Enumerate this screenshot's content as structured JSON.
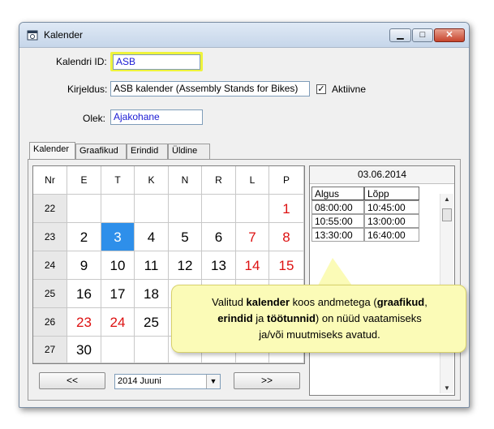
{
  "window": {
    "title": "Kalender"
  },
  "form": {
    "id_label": "Kalendri ID:",
    "id_value": "ASB",
    "desc_label": "Kirjeldus:",
    "desc_value": "ASB kalender (Assembly Stands for Bikes)",
    "active_label": "Aktiivne",
    "active_checked": "✓",
    "state_label": "Olek:",
    "state_value": "Ajakohane"
  },
  "tabs": [
    "Kalender",
    "Graafikud",
    "Erindid",
    "Üldine"
  ],
  "calendar": {
    "headers": [
      "Nr",
      "E",
      "T",
      "K",
      "N",
      "R",
      "L",
      "P"
    ],
    "rows": [
      {
        "week": "22",
        "days": [
          "",
          "",
          "",
          "",
          "",
          "",
          "1"
        ]
      },
      {
        "week": "23",
        "days": [
          "2",
          "3",
          "4",
          "5",
          "6",
          "7",
          "8"
        ]
      },
      {
        "week": "24",
        "days": [
          "9",
          "10",
          "11",
          "12",
          "13",
          "14",
          "15"
        ]
      },
      {
        "week": "25",
        "days": [
          "16",
          "17",
          "18",
          "",
          "",
          "",
          ""
        ]
      },
      {
        "week": "26",
        "days": [
          "23",
          "24",
          "25",
          "",
          "",
          "",
          ""
        ]
      },
      {
        "week": "27",
        "days": [
          "30",
          "",
          "",
          "",
          "",
          "",
          ""
        ]
      }
    ],
    "prev_label": "<<",
    "next_label": ">>",
    "month_value": "2014 Juuni",
    "selected_day": "3"
  },
  "schedule": {
    "date": "03.06.2014",
    "col_start": "Algus",
    "col_end": "Lõpp",
    "rows": [
      {
        "start": "08:00:00",
        "end": "10:45:00"
      },
      {
        "start": "10:55:00",
        "end": "13:00:00"
      },
      {
        "start": "13:30:00",
        "end": "16:40:00"
      }
    ]
  },
  "callout": {
    "l1a": "Valitud ",
    "l1b": "kalender",
    "l1c": " koos andmetega (",
    "l1d": "graafikud",
    "l1e": ",",
    "l2a": "erindid",
    "l2b": " ja ",
    "l2c": "töötunnid",
    "l2d": ") on nüüd vaatamiseks",
    "l3": "ja/või muutmiseks avatud."
  },
  "colors": {
    "selected": "#2e8fea",
    "weekend": "#dd1111",
    "callout_bg": "#fbfbb7",
    "highlight": "#eef33b"
  }
}
